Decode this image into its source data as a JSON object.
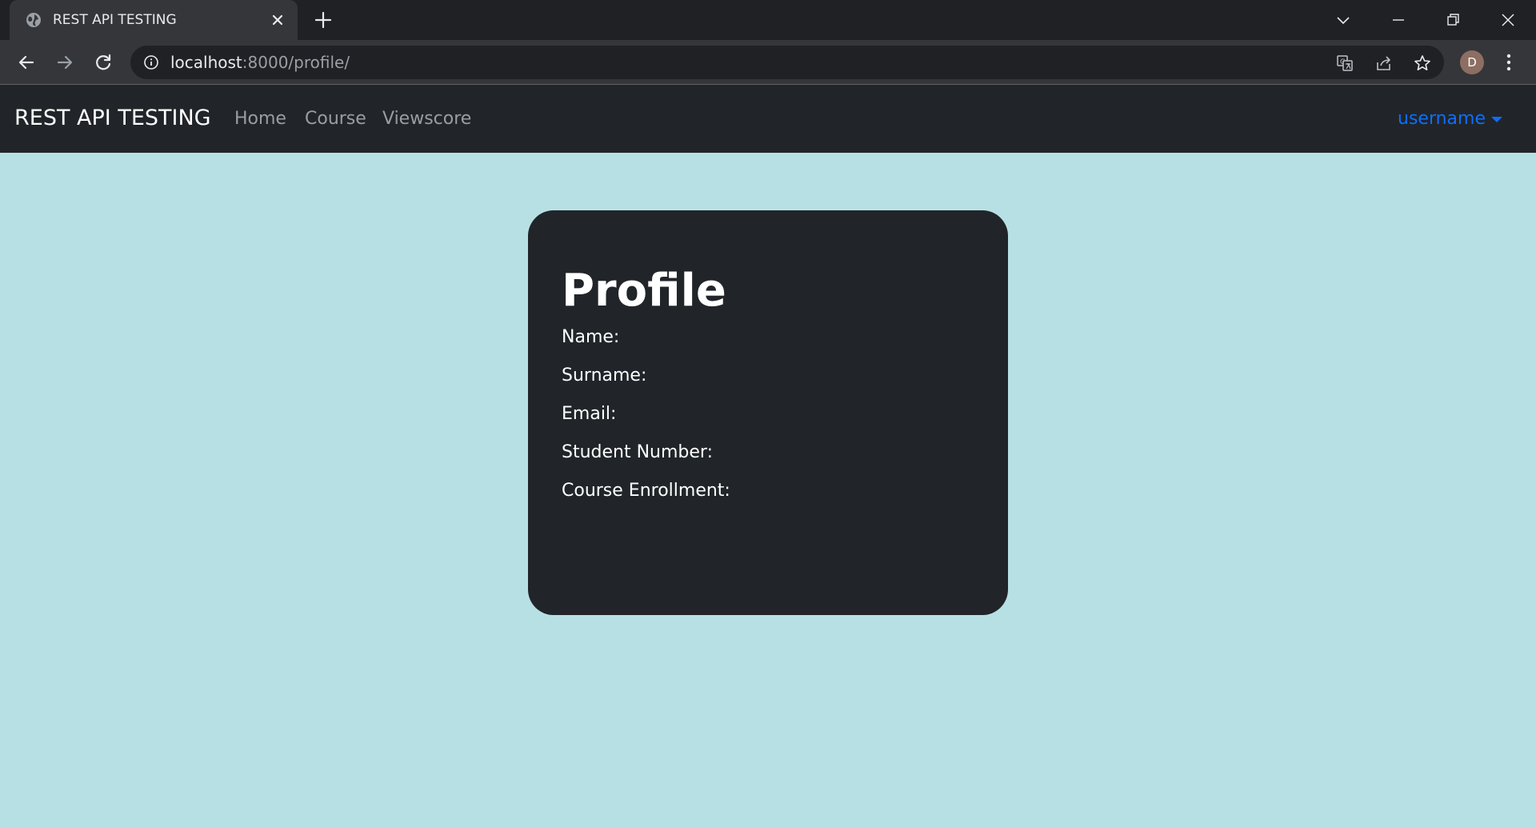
{
  "browser": {
    "tab_title": "REST API TESTING",
    "url_host": "localhost",
    "url_rest": ":8000/profile/",
    "avatar_letter": "D",
    "icons": {
      "favicon": "globe-icon",
      "tab_close": "close-icon",
      "new_tab": "plus-icon",
      "tab_search": "chevron-down-icon",
      "minimize": "minimize-icon",
      "restore": "restore-icon",
      "close_window": "close-window-icon",
      "back": "arrow-left-icon",
      "forward": "arrow-right-icon",
      "reload": "reload-icon",
      "site_info": "info-icon",
      "translate": "translate-icon",
      "share": "share-icon",
      "bookmark": "star-icon",
      "menu": "kebab-menu-icon"
    }
  },
  "navbar": {
    "brand": "REST API TESTING",
    "links": [
      "Home",
      "Course",
      "Viewscore"
    ],
    "user_menu_label": "username"
  },
  "profile": {
    "title": "Profile",
    "fields": [
      "Name:",
      "Surname:",
      "Email:",
      "Student Number:",
      "Course Enrollment:"
    ]
  },
  "colors": {
    "tabstrip_bg": "#202124",
    "toolbar_bg": "#35363a",
    "navbar_bg": "#212529",
    "page_bg": "#b7e0e4",
    "card_bg": "#212529",
    "accent_link": "#0d6efd",
    "avatar_bg": "#8d6e63"
  }
}
